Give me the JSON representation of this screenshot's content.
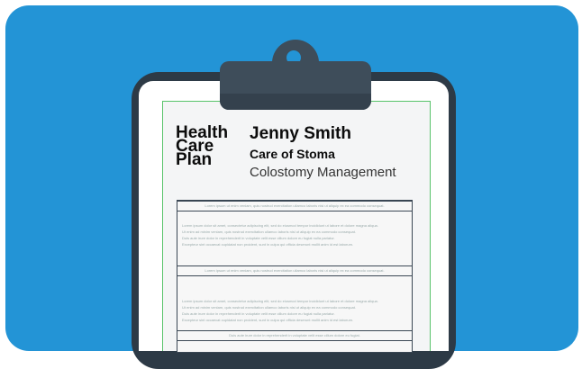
{
  "document": {
    "heading_lines": [
      "Health",
      "Care",
      "Plan"
    ],
    "patient_name": "Jenny Smith",
    "section_title": "Care of Stoma",
    "subtitle": "Colostomy Management"
  },
  "table": {
    "header_1": "Lorem ipsum ut enim veniam, quis nostrud exercitation ullamco laboris nisi ut aliquip ex ea commodo consequat.",
    "body_1": [
      "Lorem ipsum dolor sit amet, consectetur adipiscing elit, sed do eiusmod tempor incididunt ut labore et dolore magna aliqua.",
      "Ut enim ad minim veniam, quis nostrud exercitation ullamco laboris nisi ut aliquip ex ea commodo consequat.",
      "Duis aute irure dolor in reprehenderit in voluptate velit esse cillum dolore eu fugiat nulla pariatur.",
      "Excepteur sint occaecat cupidatat non proident, sunt in culpa qui officia deserunt mollit anim id est laborum."
    ],
    "header_2": "Lorem ipsum ut enim veniam, quis nostrud exercitation ullamco laboris nisi ut aliquip ex ea commodo consequat.",
    "body_2": [
      "Lorem ipsum dolor sit amet, consectetur adipiscing elit, sed do eiusmod tempor incididunt ut labore et dolore magna aliqua.",
      "Ut enim ad minim veniam, quis nostrud exercitation ullamco laboris nisi ut aliquip ex ea commodo consequat.",
      "Duis aute irure dolor in reprehenderit in voluptate velit esse cillum dolore eu fugiat nulla pariatur.",
      "Excepteur sint occaecat cupidatat non proident, sunt in culpa qui officia deserunt mollit anim id est laborum."
    ],
    "header_3": "Duis aute irure dolor in reprehenderit in voluptate velit esse cillum dolore eu fugiat."
  }
}
